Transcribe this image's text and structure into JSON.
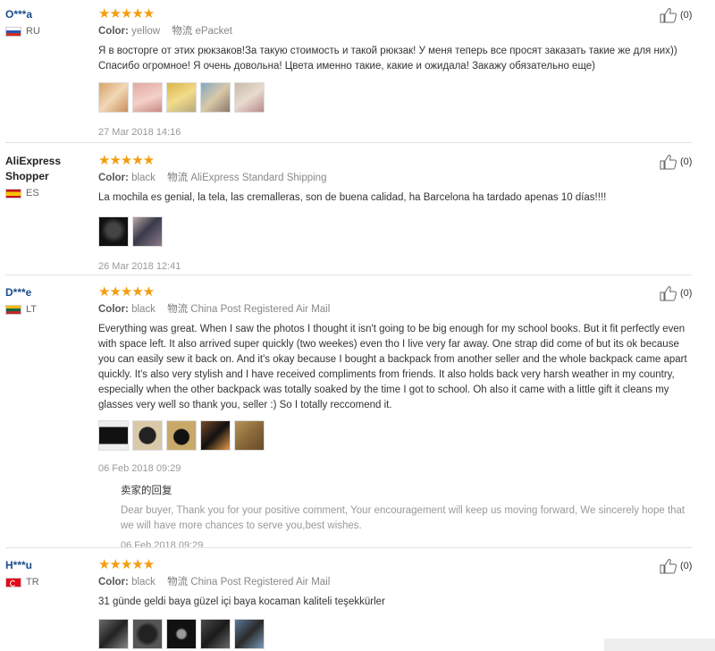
{
  "reviews": [
    {
      "user": "O***a",
      "country": "RU",
      "stars": "★★★★★",
      "color_label": "Color:",
      "color": "yellow",
      "ship_label": "物流",
      "ship": "ePacket",
      "text": "Я в восторге от этих рюкзаков!За такую стоимость и такой рюкзак! У меня теперь все просят заказать такие же для них)) Спасибо огромное! Я очень довольна! Цвета именно такие, какие и ожидала! Закажу обязательно еще)",
      "photo_count": 5,
      "date": "27 Mar 2018 14:16",
      "likes": "(0)"
    },
    {
      "user": "AliExpress Shopper",
      "country": "ES",
      "stars": "★★★★★",
      "color_label": "Color:",
      "color": "black",
      "ship_label": "物流",
      "ship": "AliExpress Standard Shipping",
      "text": "La mochila es genial, la tela, las cremalleras, son de buena calidad, ha Barcelona ha tardado apenas 10 días!!!!",
      "photo_count": 2,
      "date": "26 Mar 2018 12:41",
      "likes": "(0)"
    },
    {
      "user": "D***e",
      "country": "LT",
      "stars": "★★★★★",
      "color_label": "Color:",
      "color": "black",
      "ship_label": "物流",
      "ship": "China Post Registered Air Mail",
      "text": "Everything was great. When I saw the photos I thought it isn't going to be big enough for my school books. But it fit perfectly even with space left. It also arrived super quickly (two weekes) even tho I live very far away. One strap did come of but its ok because you can easily sew it back on. And it's okay because I bought a backpack from another seller and the whole backpack came apart quickly. It's also very stylish and I have received compliments from friends. It also holds back very harsh weather in my country, especially when the other backpack was totally soaked by the time I got to school. Oh also it came with a little gift it cleans my glasses very well so thank you, seller :) So I totally reccomend it.",
      "photo_count": 5,
      "date": "06 Feb 2018 09:29",
      "reply_title": "卖家的回复",
      "reply_text": "Dear buyer, Thank you for your positive comment, Your encouragement will keep us moving forward, We sincerely hope that we will have more chances to serve you,best wishes.",
      "reply_date": "06 Feb 2018 09:29",
      "likes": "(0)"
    },
    {
      "user": "H***u",
      "country": "TR",
      "stars": "★★★★★",
      "color_label": "Color:",
      "color": "black",
      "ship_label": "物流",
      "ship": "China Post Registered Air Mail",
      "text": "31 günde geldi baya güzel içi baya kocaman kaliteli teşekkürler",
      "photo_count": 5,
      "likes": "(0)"
    }
  ],
  "colors": {
    "star": "#f39d0f",
    "username": "#1a4d8c"
  }
}
